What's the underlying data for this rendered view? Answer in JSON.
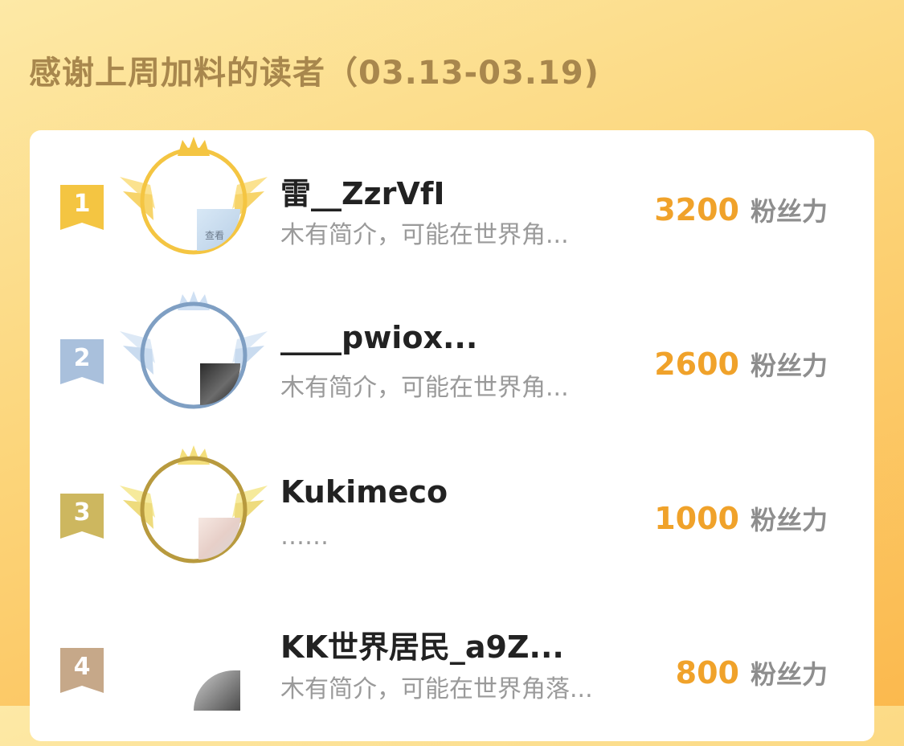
{
  "header": {
    "title": "感谢上周加料的读者（03.13-03.19)"
  },
  "colors": {
    "gold": "#f4c542",
    "silver": "#7f9fc3",
    "bronze": "#c9b15a",
    "fourth": "#c6a889",
    "accent_value": "#f0a22a"
  },
  "readers": [
    {
      "rank": "1",
      "name": "雷__ZzrVfI",
      "bio": "木有简介，可能在世界角...",
      "power_value": "3200",
      "power_unit": "粉丝力",
      "avatar_label": "查看"
    },
    {
      "rank": "2",
      "name": "____pwiox...",
      "bio": "木有简介，可能在世界角...",
      "power_value": "2600",
      "power_unit": "粉丝力"
    },
    {
      "rank": "3",
      "name": "Kukimeco",
      "bio": "……",
      "power_value": "1000",
      "power_unit": "粉丝力"
    },
    {
      "rank": "4",
      "name": "KK世界居民_a9Z...",
      "bio": "木有简介，可能在世界角落...",
      "power_value": "800",
      "power_unit": "粉丝力"
    }
  ]
}
